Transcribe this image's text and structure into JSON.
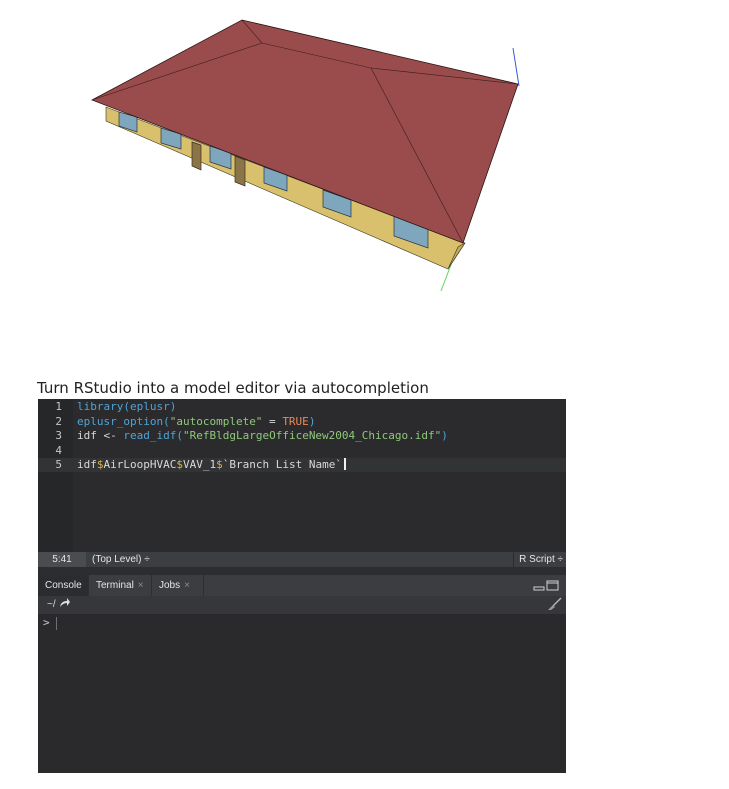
{
  "caption": "Turn RStudio into a model editor via autocompletion",
  "editor": {
    "lines": [
      {
        "n": "1",
        "parts": [
          {
            "t": "library(",
            "c": "fn"
          },
          {
            "t": "eplusr",
            "c": "fn"
          },
          {
            "t": ")",
            "c": "fn"
          }
        ]
      },
      {
        "n": "2",
        "parts": [
          {
            "t": "eplusr_option(",
            "c": "fn"
          },
          {
            "t": "\"autocomplete\"",
            "c": "str"
          },
          {
            "t": " = ",
            "c": "op"
          },
          {
            "t": "TRUE",
            "c": "true"
          },
          {
            "t": ")",
            "c": "fn"
          }
        ]
      },
      {
        "n": "3",
        "parts": [
          {
            "t": "idf ",
            "c": "id"
          },
          {
            "t": "<-",
            "c": "op"
          },
          {
            "t": " read_idf(",
            "c": "fn"
          },
          {
            "t": "\"RefBldgLargeOfficeNew2004_Chicago.idf\"",
            "c": "str"
          },
          {
            "t": ")",
            "c": "fn"
          }
        ]
      },
      {
        "n": "4",
        "parts": []
      },
      {
        "n": "5",
        "active": true,
        "parts": [
          {
            "t": "idf",
            "c": "id"
          },
          {
            "t": "$",
            "c": "dollar"
          },
          {
            "t": "AirLoopHVAC",
            "c": "id"
          },
          {
            "t": "$",
            "c": "dollar"
          },
          {
            "t": "VAV_1",
            "c": "id"
          },
          {
            "t": "$",
            "c": "dollar"
          },
          {
            "t": "`Branch List Name`",
            "c": "tick"
          }
        ]
      }
    ]
  },
  "status": {
    "position": "5:41",
    "scope": "(Top Level) ÷",
    "file_type": "R Script ÷"
  },
  "console_tabs": [
    {
      "label": "Console",
      "active": true,
      "close": ""
    },
    {
      "label": "Terminal",
      "active": false,
      "close": "×"
    },
    {
      "label": "Jobs",
      "active": false,
      "close": "×"
    }
  ],
  "console": {
    "path": "~/",
    "prompt": ">"
  },
  "colors": {
    "roof": "#9a4b4c",
    "wall_front": "#d8c06c",
    "wall_side": "#c8ad58",
    "window": "#7ea6bd",
    "door": "#8b7448"
  }
}
